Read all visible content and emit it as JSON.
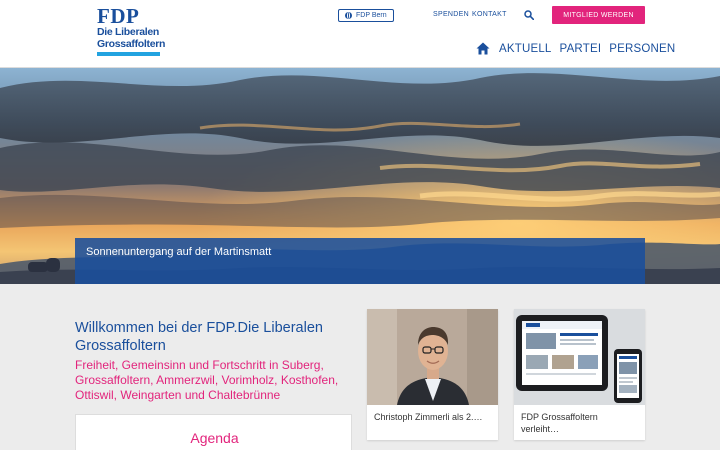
{
  "header": {
    "logo": {
      "brand": "FDP",
      "line1": "Die Liberalen",
      "line2": "Grossaffoltern"
    },
    "top_links": {
      "bern": "FDP Bern",
      "spenden": "SPENDEN",
      "kontakt": "KONTAKT"
    },
    "member_button": "MITGLIED WERDEN",
    "nav": [
      "AKTUELL",
      "PARTEI",
      "PERSONEN"
    ]
  },
  "hero": {
    "caption": "Sonnenuntergang auf der Martinsmatt"
  },
  "main": {
    "welcome_title": "Willkommen bei der FDP.Die Liberalen Grossaffoltern",
    "welcome_subtitle": "Freiheit, Gemeinsinn und Fortschritt in Suberg, Grossaffoltern, Ammerzwil, Vorimholz, Kosthofen, Ottiswil, Weingarten und Chaltebrünne",
    "agenda_title": "Agenda",
    "cards": [
      {
        "title": "Christoph Zimmerli als 2.…"
      },
      {
        "title": "FDP Grossaffoltern verleiht…"
      }
    ]
  },
  "colors": {
    "brand_blue": "#1a4f9c",
    "accent_pink": "#e2247c",
    "logo_bar": "#22a3e0"
  }
}
